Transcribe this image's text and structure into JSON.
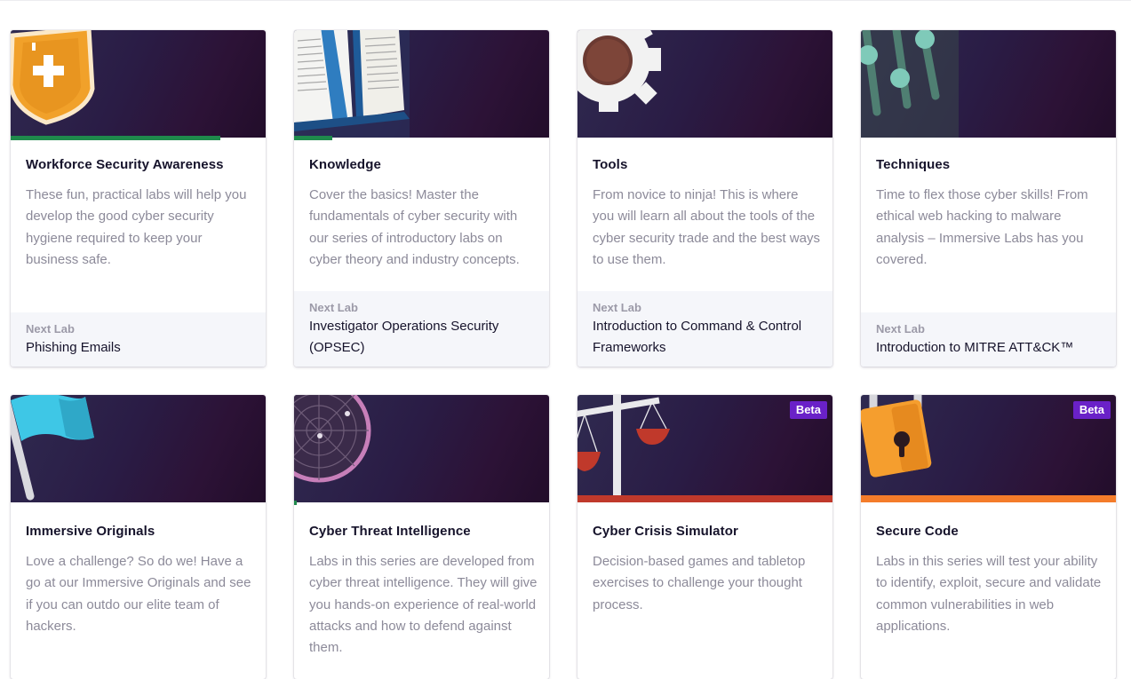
{
  "cards": [
    {
      "title": "Workforce Security Awareness",
      "description": "These fun, practical labs will help you develop the good cyber security hygiene required to keep your business safe.",
      "next_label": "Next Lab",
      "next_value": "Phishing Emails",
      "progress": 0.82,
      "icon": "shield-plus-icon"
    },
    {
      "title": "Knowledge",
      "description": "Cover the basics! Master the fundamentals of cyber security with our series of introductory labs on cyber theory and industry concepts.",
      "next_label": "Next Lab",
      "next_value": "Investigator Operations Security (OPSEC)",
      "progress": 0.15,
      "icon": "open-book-icon"
    },
    {
      "title": "Tools",
      "description": "From novice to ninja! This is where you will learn all about the tools of the cyber security trade and the best ways to use them.",
      "next_label": "Next Lab",
      "next_value": "Introduction to Command & Control Frameworks",
      "progress": 0,
      "icon": "gear-icon"
    },
    {
      "title": "Techniques",
      "description": "Time to flex those cyber skills! From ethical web hacking to malware analysis – Immersive Labs has you covered.",
      "next_label": "Next Lab",
      "next_value": "Introduction to MITRE ATT&CK™",
      "progress": 0,
      "icon": "sliders-icon"
    },
    {
      "title": "Immersive Originals",
      "description": "Love a challenge? So do we! Have a go at our Immersive Originals and see if you can outdo our elite team of hackers.",
      "icon": "flag-icon"
    },
    {
      "title": "Cyber Threat Intelligence",
      "description": "Labs in this series are developed from cyber threat intelligence. They will give you hands-on experience of real-world attacks and how to defend against them.",
      "icon": "radar-icon"
    },
    {
      "title": "Cyber Crisis Simulator",
      "description": "Decision-based games and tabletop exercises to challenge your thought process.",
      "badge": "Beta",
      "icon": "scales-icon"
    },
    {
      "title": "Secure Code",
      "description": "Labs in this series will test your ability to identify, exploit, secure and validate common vulnerabilities in web applications.",
      "badge": "Beta",
      "icon": "padlock-icon"
    }
  ],
  "colors": {
    "progress": "#1f8a4c",
    "beta_badge": "#6a21c8",
    "crisis_accent": "#c0392b",
    "secure_code_accent": "#f47c2a"
  }
}
